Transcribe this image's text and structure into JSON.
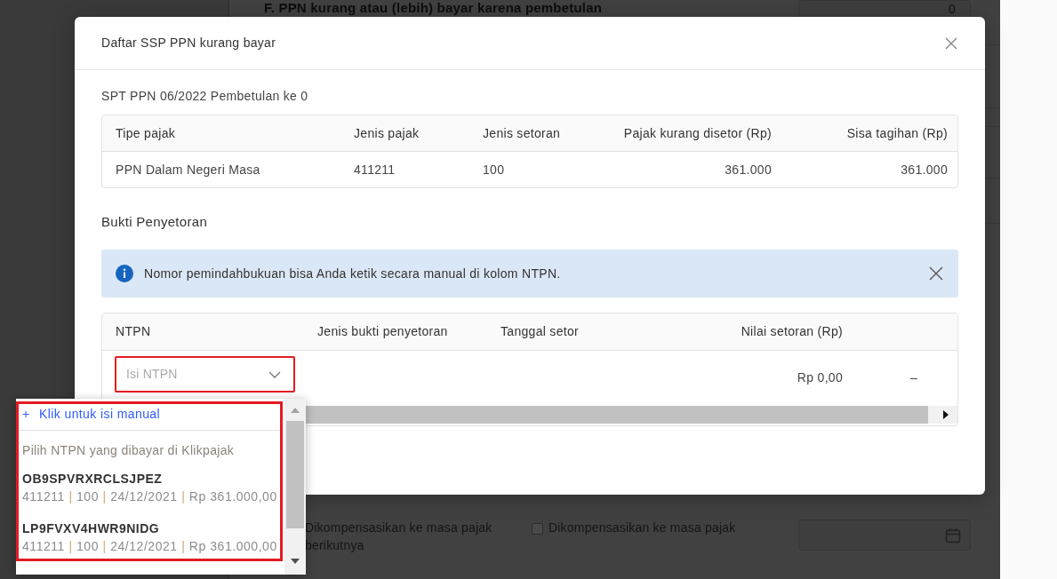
{
  "background_page": {
    "row_label": "F. PPN kurang atau (lebih) bayar karena pembetulan",
    "row_value": "0",
    "compensation_text": "Dikompensasikan ke masa pajak berikutnya",
    "compensation_option": {
      "label": "Dikompensasikan ke masa pajak",
      "checked": false
    }
  },
  "dialog": {
    "title": "Daftar SSP PPN kurang bayar",
    "subtitle": "SPT PPN 06/2022 Pembetulan ke 0",
    "tax_table": {
      "columns": [
        "Tipe pajak",
        "Jenis pajak",
        "Jenis setoran",
        "Pajak kurang disetor (Rp)",
        "Sisa tagihan (Rp)"
      ],
      "rows": [
        [
          "PPN Dalam Negeri Masa",
          "411211",
          "100",
          "361.000",
          "361.000"
        ]
      ]
    },
    "section_title": "Bukti Penyetoran",
    "notice": {
      "text": "Nomor pemindahbukuan bisa Anda ketik secara manual di kolom NTPN."
    },
    "payment_table": {
      "columns": [
        "NTPN",
        "Jenis bukti penyetoran",
        "Tanggal setor",
        "Nilai setoran (Rp)"
      ],
      "rows": [
        {
          "ntpn_field": {
            "placeholder": "Isi NTPN",
            "highlighted": true,
            "expanded": true,
            "dropdown": {
              "highlighted": true,
              "manual_entry": {
                "icon": "+",
                "label": "Klik untuk isi manual"
              },
              "group_label": "Pilih NTPN yang dibayar di Klikpajak",
              "options": [
                {
                  "ntpn": "OB9SPVRXRCLSJPEZ",
                  "selected": false,
                  "detail": [
                    {
                      "kind": "value",
                      "text": "411211"
                    },
                    {
                      "kind": "separator",
                      "text": " | "
                    },
                    {
                      "kind": "value",
                      "text": "100"
                    },
                    {
                      "kind": "separator",
                      "text": " | "
                    },
                    {
                      "kind": "value",
                      "text": "24/12/2021"
                    },
                    {
                      "kind": "separator",
                      "text": " | "
                    },
                    {
                      "kind": "value",
                      "text": "Rp 361.000,00"
                    }
                  ]
                },
                {
                  "ntpn": "LP9FVXV4HWR9NIDG",
                  "selected": false,
                  "detail": [
                    {
                      "kind": "value",
                      "text": "411211"
                    },
                    {
                      "kind": "separator",
                      "text": " | "
                    },
                    {
                      "kind": "value",
                      "text": "100"
                    },
                    {
                      "kind": "separator",
                      "text": " | "
                    },
                    {
                      "kind": "value",
                      "text": "24/12/2021"
                    },
                    {
                      "kind": "separator",
                      "text": " | "
                    },
                    {
                      "kind": "value",
                      "text": "Rp 361.000,00"
                    }
                  ]
                }
              ]
            }
          },
          "amount": "Rp 0,00",
          "column_5": "–"
        }
      ]
    }
  }
}
